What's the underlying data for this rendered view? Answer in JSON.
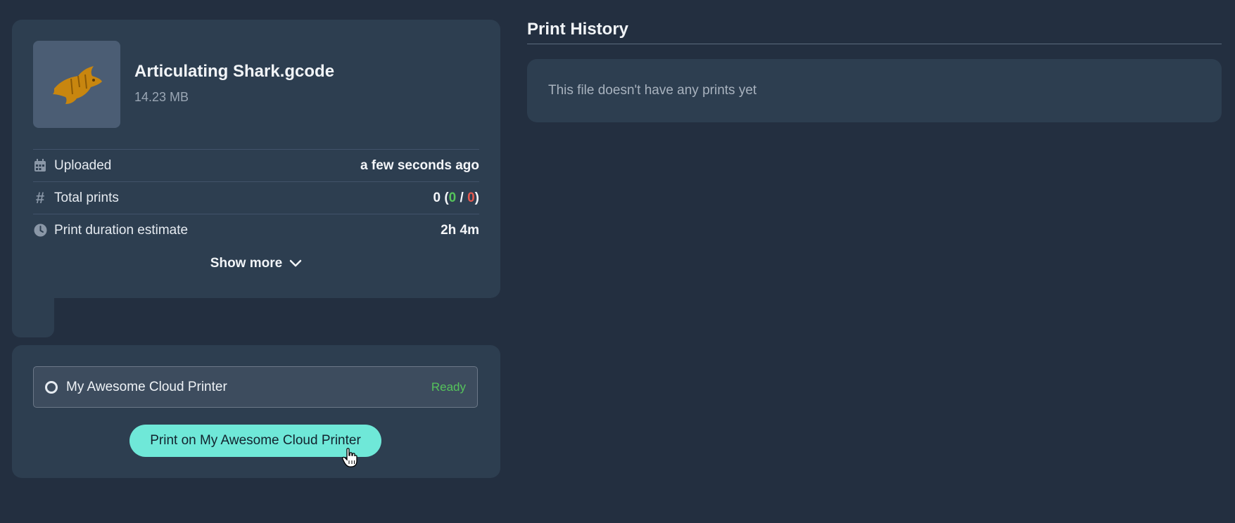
{
  "file": {
    "name": "Articulating Shark.gcode",
    "size": "14.23 MB",
    "thumbnail_icon": "shark-model-thumbnail"
  },
  "details": {
    "uploaded_label": "Uploaded",
    "uploaded_value": "a few seconds ago",
    "total_prints_label": "Total prints",
    "total_prints_count": "0",
    "total_prints_success": "0",
    "total_prints_failed": "0",
    "duration_label": "Print duration estimate",
    "duration_value": "2h 4m",
    "show_more_label": "Show more"
  },
  "printer": {
    "name": "My Awesome Cloud Printer",
    "status": "Ready",
    "print_button_label": "Print on My Awesome Cloud Printer"
  },
  "history": {
    "title": "Print History",
    "empty_message": "This file doesn't have any prints yet"
  },
  "colors": {
    "background": "#232f40",
    "card": "#2d3e50",
    "accent_button": "#6fe8d8",
    "success": "#55c35b",
    "failure": "#e5584f"
  }
}
